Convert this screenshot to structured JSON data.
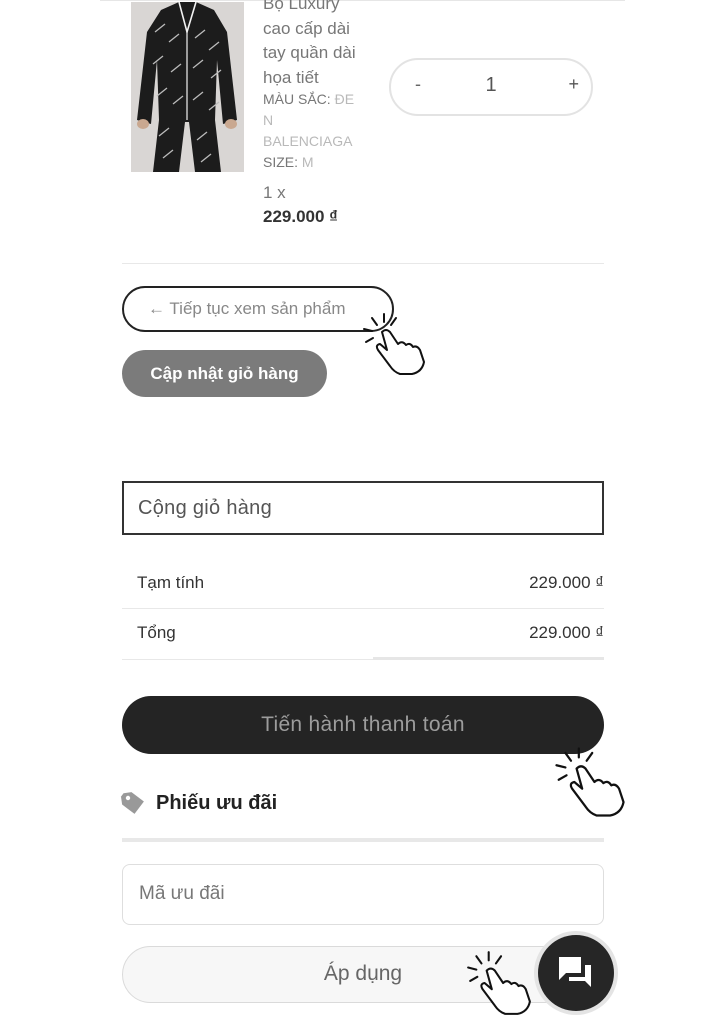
{
  "product": {
    "name": "Bộ Đồ Luxury cao cấp dài tay quần dài họa tiết",
    "name_visible": [
      "Bộ Luxury",
      "cao cấp dài",
      "tay quần dài",
      "họa tiết"
    ],
    "color_label": "MÀU SẮC:",
    "color_value_parts": [
      "ĐE",
      "N",
      "BALENCIAGA"
    ],
    "size_label": "SIZE:",
    "size_value": "M",
    "quantity_line": "1 x",
    "price": "229.000 ₫",
    "stepper": {
      "minus": "-",
      "value": "1",
      "plus": "+"
    }
  },
  "actions": {
    "continue_label": "← Tiếp tục xem sản phẩm",
    "update_label": "Cập nhật giỏ hàng"
  },
  "totals": {
    "heading": "Cộng giỏ hàng",
    "rows": [
      {
        "label": "Tạm tính",
        "value": "229.000 ₫"
      },
      {
        "label": "Tổng",
        "value": "229.000 ₫"
      }
    ],
    "checkout_label": "Tiến hành thanh toán"
  },
  "coupon": {
    "title": "Phiếu ưu đãi",
    "input_placeholder": "Mã ưu đãi",
    "apply_label": "Áp dụng"
  },
  "icons": {
    "coupon": "tag-icon",
    "chat": "chat-icon",
    "pointer": "hand-pointer-icon"
  },
  "colors": {
    "primary_dark": "#242424",
    "update_button": "#7b7b7b"
  }
}
